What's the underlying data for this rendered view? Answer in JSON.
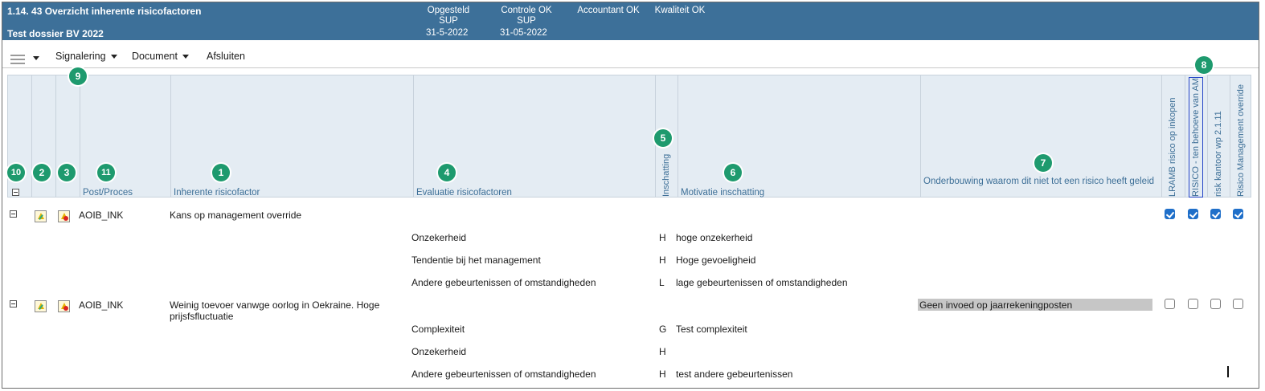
{
  "window": {
    "title": "1.14. 43 Overzicht inherente risicofactoren",
    "dossier": "Test dossier BV 2022"
  },
  "status": {
    "opgesteld": {
      "label": "Opgesteld",
      "by": "SUP",
      "date": "31-5-2022"
    },
    "controle": {
      "label": "Controle OK",
      "by": "SUP",
      "date": "31-05-2022"
    },
    "accountant": {
      "label": "Accountant OK"
    },
    "kwaliteit": {
      "label": "Kwaliteit OK"
    }
  },
  "toolbar": {
    "signalering": "Signalering",
    "document": "Document",
    "afsluiten": "Afsluiten"
  },
  "columns": {
    "post": "Post/Proces",
    "factor": "Inherente risicofactor",
    "evaluatie": "Evaluatie risicofactoren",
    "inschatting": "Inschatting",
    "motivatie": "Motivatie inschatting",
    "onderbouwing": "Onderbouwing waarom dit niet tot een risico heeft geleid",
    "v1": "LRAMB risico op inkopen",
    "v2": "RISICO - ten behoeve van AM",
    "v3": "risk kantoor wp 2.1.11",
    "v4": "Risico Management override"
  },
  "badges": [
    "1",
    "2",
    "3",
    "4",
    "5",
    "6",
    "7",
    "8",
    "9",
    "10",
    "11"
  ],
  "icons": {
    "hamburger": "hamburger-icon",
    "caret": "chevron-down-icon",
    "collapse": "collapse-icon",
    "signal": "warning-icon",
    "document": "document-icon",
    "checkbox": "checkbox-icon"
  },
  "rows": [
    {
      "post": "AOIB_INK",
      "factor": "Kans op management override",
      "onderbouwing": "",
      "checks": [
        true,
        true,
        true,
        true
      ],
      "evaluaties": [
        {
          "label": "Onzekerheid",
          "inschatting": "H",
          "motivatie": "hoge onzekerheid"
        },
        {
          "label": "Tendentie bij het management",
          "inschatting": "H",
          "motivatie": "Hoge gevoeligheid"
        },
        {
          "label": "Andere gebeurtenissen of omstandigheden",
          "inschatting": "L",
          "motivatie": "lage gebeurtenissen of omstandigheden"
        }
      ]
    },
    {
      "post": "AOIB_INK",
      "factor": "Weinig toevoer vanwge oorlog in Oekraine. Hoge prijsfsfluctuatie",
      "onderbouwing": "Geen invoed op jaarrekeningposten",
      "checks": [
        false,
        false,
        false,
        false
      ],
      "evaluaties": [
        {
          "label": "Complexiteit",
          "inschatting": "G",
          "motivatie": "Test complexiteit"
        },
        {
          "label": "Onzekerheid",
          "inschatting": "H",
          "motivatie": ""
        },
        {
          "label": "Andere gebeurtenissen of omstandigheden",
          "inschatting": "H",
          "motivatie": "test andere gebeurtenissen"
        }
      ]
    }
  ],
  "colors": {
    "titlebar": "#3d7099",
    "header": "#e4ecf3",
    "badge": "#1e9a6e",
    "checkbox": "#1f6fc9"
  }
}
